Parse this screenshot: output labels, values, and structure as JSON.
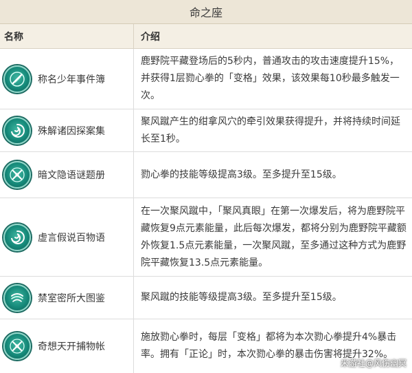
{
  "title": "命之座",
  "header": {
    "name": "名称",
    "desc": "介绍"
  },
  "rows": [
    {
      "name": "称名少年事件簿",
      "icon": "constellation-slash-icon",
      "desc": "鹿野院平藏登场后的5秒内，普通攻击的攻击速度提升15%，并获得1层勠心拳的「变格」效果，该效果每10秒最多触发一次。"
    },
    {
      "name": "殊解诸因探案集",
      "icon": "constellation-swirl-icon",
      "desc": "聚风蹴产生的绀拿风穴的牵引效果获得提升，并将持续时间延长至1秒。"
    },
    {
      "name": "暗文隐语谜题册",
      "icon": "constellation-cross-icon",
      "desc": "勠心拳的技能等级提高3级。至多提升至15级。"
    },
    {
      "name": "虚言假说百物语",
      "icon": "constellation-swirl-icon",
      "desc": "在一次聚风蹴中，「聚风真眼」在第一次爆发后，将为鹿野院平藏恢复9点元素能量，此后每次爆发，都将分别为鹿野院平藏额外恢复1.5点元素能量，一次聚风蹴，至多通过这种方式为鹿野院平藏恢复13.5点元素能量。"
    },
    {
      "name": "禁室密所大图鉴",
      "icon": "constellation-wind-icon",
      "desc": "聚风蹴的技能等级提高3级。至多提升至15级。"
    },
    {
      "name": "奇想天开捕物帐",
      "icon": "constellation-cross-icon",
      "desc": "施放勠心拳时，每层「变格」都将为本次勠心拳提升4%暴击率。拥有「正论」时，本次勠心拳的暴击伤害将提升32%。"
    }
  ],
  "watermark": "米游社@风伤幽冥"
}
